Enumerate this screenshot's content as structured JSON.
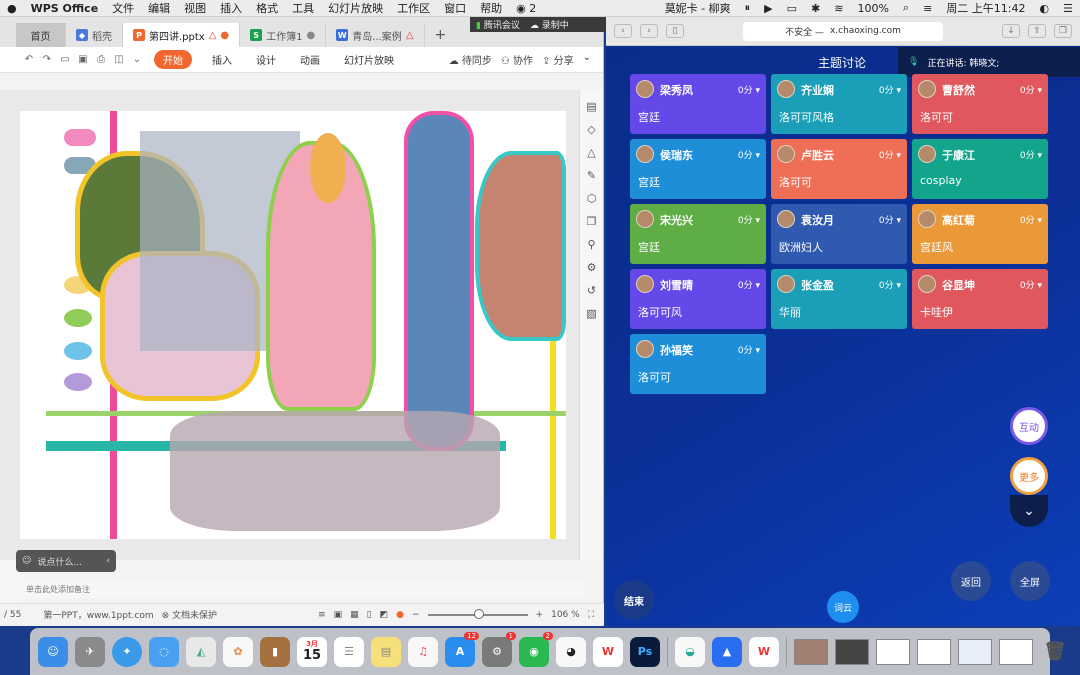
{
  "menubar": {
    "app": "WPS Office",
    "items": [
      "文件",
      "编辑",
      "视图",
      "插入",
      "格式",
      "工具",
      "幻灯片放映",
      "工作区",
      "窗口",
      "帮助"
    ],
    "wechat_count": "2",
    "user_label": "莫妮卡 - 柳爽",
    "battery": "100%",
    "datetime": "周二 上午11:42"
  },
  "meeting_bar": {
    "app": "腾讯会议",
    "recording": "录制中"
  },
  "wps": {
    "tabs": [
      {
        "label": "首页"
      },
      {
        "label": "稻壳"
      },
      {
        "label": "第四讲.pptx"
      },
      {
        "label": "工作簿1"
      },
      {
        "label": "青岛...案例"
      }
    ],
    "toolbar": {
      "start": "开始",
      "menus": [
        "插入",
        "设计",
        "动画",
        "幻灯片放映"
      ],
      "sync": "待同步",
      "collab": "协作",
      "share": "分享"
    },
    "notes_placeholder": "单击此处添加备注",
    "comment_placeholder": "说点什么...",
    "status": {
      "page": "/ 55",
      "template": "第一PPT，www.1ppt.com",
      "protect": "文档未保护",
      "zoom": "106 %"
    }
  },
  "browser": {
    "url_prefix": "不安全 —",
    "url": "x.chaoxing.com",
    "topic_title": "主题讨论",
    "speaking": "正在讲话: 韩晓文;",
    "cards": [
      {
        "name": "梁秀凤",
        "score": "0分",
        "answer": "宫廷",
        "color": "#6448e8"
      },
      {
        "name": "齐业娴",
        "score": "0分",
        "answer": "洛可可风格",
        "color": "#1b9fb8"
      },
      {
        "name": "曹舒然",
        "score": "0分",
        "answer": "洛可可",
        "color": "#e0585e"
      },
      {
        "name": "侯瑞东",
        "score": "0分",
        "answer": "宫廷",
        "color": "#1e8ed8"
      },
      {
        "name": "卢胜云",
        "score": "0分",
        "answer": "洛可可",
        "color": "#ee6f55"
      },
      {
        "name": "于康江",
        "score": "0分",
        "answer": "cosplay",
        "color": "#12a58c"
      },
      {
        "name": "宋光兴",
        "score": "0分",
        "answer": "宫廷",
        "color": "#5fae45"
      },
      {
        "name": "袁汝月",
        "score": "0分",
        "answer": "欧洲妇人",
        "color": "#2f5ab0"
      },
      {
        "name": "高红菊",
        "score": "0分",
        "answer": "宫廷风",
        "color": "#eb9838"
      },
      {
        "name": "刘雪晴",
        "score": "0分",
        "answer": "洛可可风",
        "color": "#6448e8"
      },
      {
        "name": "张金盈",
        "score": "0分",
        "answer": "华丽",
        "color": "#1b9fb8"
      },
      {
        "name": "谷显坤",
        "score": "0分",
        "answer": "卡哇伊",
        "color": "#e0585e"
      },
      {
        "name": "孙福笑",
        "score": "0分",
        "answer": "洛可可",
        "color": "#1e8ed8"
      }
    ],
    "buttons": {
      "interact": "互动",
      "more": "更多",
      "back": "返回",
      "fullscreen": "全屏",
      "end": "结束",
      "wordcloud": "词云"
    }
  },
  "dock": {
    "calendar_month": "3月",
    "calendar_day": "15",
    "appstore_badge": "12",
    "settings_badge": "1",
    "wechat_badge": "2",
    "ps_label": "Ps"
  }
}
